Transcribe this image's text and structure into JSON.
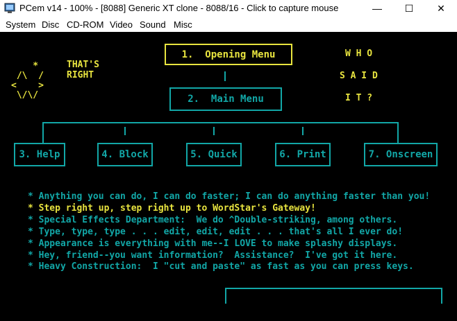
{
  "window": {
    "title": "PCem v14 - 100% - [8088] Generic XT clone - 8088/16 - Click to capture mouse",
    "minimize_glyph": "—",
    "maximize_glyph": "☐",
    "close_glyph": "✕"
  },
  "menu": [
    "System",
    "Disc",
    "CD-ROM",
    "Video",
    "Sound",
    "Misc"
  ],
  "screen": {
    "face_line1": "    *",
    "face_line2": " /\\  /",
    "face_line3": "<    >",
    "face_line4": " \\/\\/",
    "thats_right_1": "THAT'S",
    "thats_right_2": "RIGHT",
    "who_1": "W H O",
    "who_2": "S A I D",
    "who_3": "I T ?",
    "menu_opening": "1.  Opening Menu",
    "menu_main": "2.  Main Menu",
    "menu_help": "3. Help",
    "menu_block": "4. Block",
    "menu_quick": "5. Quick",
    "menu_print": "6. Print",
    "menu_onscreen": "7. Onscreen",
    "lines": [
      "* Anything you can do, I can do faster; I can do anything faster than you!",
      "* Step right up, step right up to WordStar's Gateway!",
      "* Special Effects Department:  We do ^Double-striking, among others.",
      "* Type, type, type . . . edit, edit, edit . . . that's all I ever do!",
      "* Appearance is everything with me--I LOVE to make splashy displays.",
      "* Hey, friend--you want information?  Assistance?  I've got it here.",
      "* Heavy Construction:  I \"cut and paste\" as fast as you can press keys."
    ]
  }
}
